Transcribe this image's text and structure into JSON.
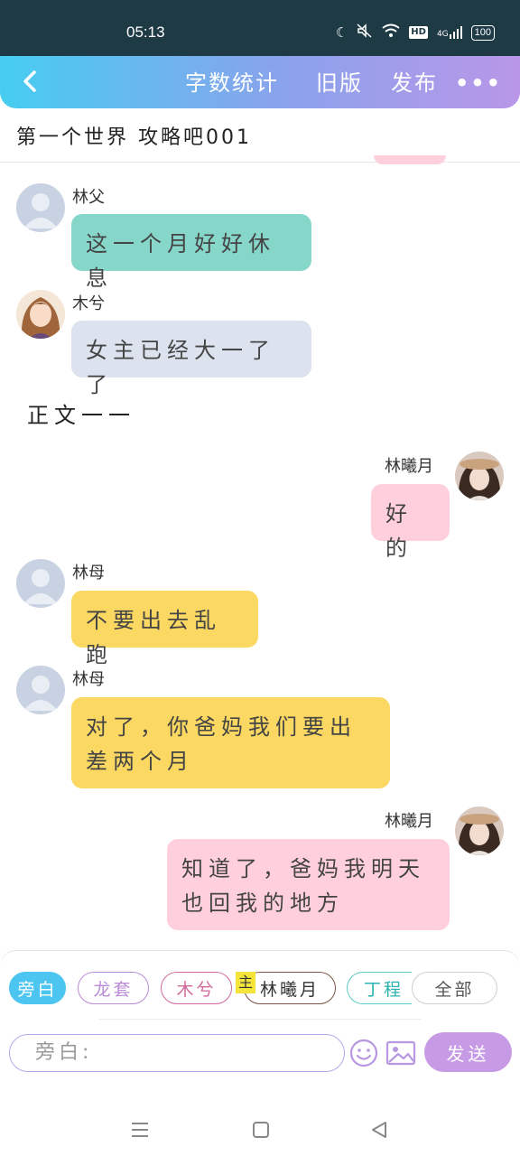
{
  "status_bar": {
    "time": "05:13",
    "hd": "HD",
    "network": "4G",
    "battery": "100"
  },
  "header": {
    "word_count": "字数统计",
    "old_version": "旧版",
    "publish": "发布",
    "more": "•••"
  },
  "title": "第一个世界 攻略吧001",
  "messages": [
    {
      "speaker": "林父",
      "text": "这一个月好好休息"
    },
    {
      "speaker": "木兮",
      "text": "女主已经大一了了"
    },
    {
      "speaker": "林母",
      "text": "不要出去乱跑"
    },
    {
      "speaker": "林母",
      "text_line1": "对了，你爸妈我们要出",
      "text_line2": "差两个月"
    }
  ],
  "narration": "正文一一",
  "my_messages": [
    {
      "speaker": "林曦月",
      "text": "好的"
    },
    {
      "speaker": "林曦月",
      "text_line1": "知道了，爸妈我明天",
      "text_line2": "也回我的地方"
    }
  ],
  "role_chips": [
    "旁白",
    "龙套",
    "木兮",
    "林曦月",
    "丁程",
    "全部"
  ],
  "main_badge": "主",
  "input": {
    "placeholder": "旁白:"
  },
  "send_label": "发送",
  "colors": {
    "lin_father_bubble": "#86d6ca",
    "muxi_bubble": "#dde3ee",
    "lin_mother_bubble": "#fbd862",
    "me_bubble": "#ffd0dc",
    "send_button": "#c79ae6"
  }
}
